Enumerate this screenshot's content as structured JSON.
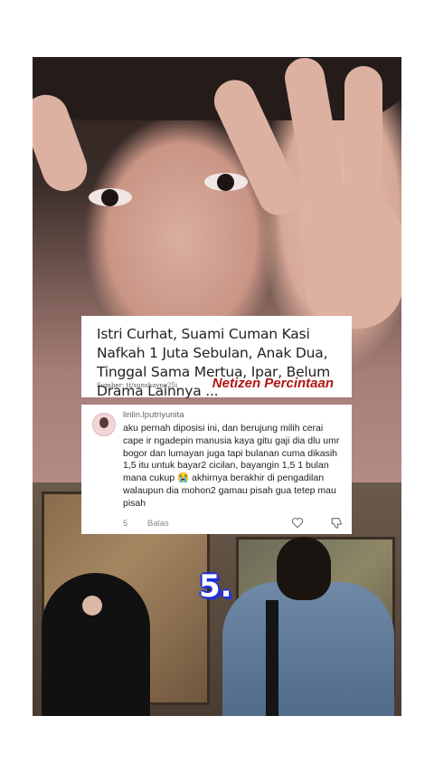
{
  "headline": {
    "text": "Istri Curhat, Suami Cuman Kasi Nafkah 1 Juta Sebulan, Anak Dua, Tinggal Sama Mertua, Ipar, Belum Drama Lainnya ...",
    "source": "Sumber: tt/sunshayne25i",
    "brand": "Netizen Percintaan"
  },
  "comment": {
    "username": "linlin.lputriyunita",
    "text": "aku pernah diposisi ini, dan berujung milih cerai cape ",
    "text_cont": "ir ngadepin manusia kaya gitu gaji dia dlu umr bogor dan lumayan juga tapi bulanan cuma dikasih 1,5 itu untuk bayar2 cicilan, bayangin 1,5 1 bulan mana cukup 😭 akhirnya berakhir di pengadilan walaupun dia mohon2 gamau pisah gua tetep mau pisah",
    "likes": "5",
    "reply_label": "Balas"
  },
  "overlay": {
    "number": "5."
  },
  "icons": {
    "heart": "heart-icon",
    "dislike": "dislike-icon"
  },
  "colors": {
    "brand": "#b01515",
    "number_outline": "#1d2fe0"
  }
}
